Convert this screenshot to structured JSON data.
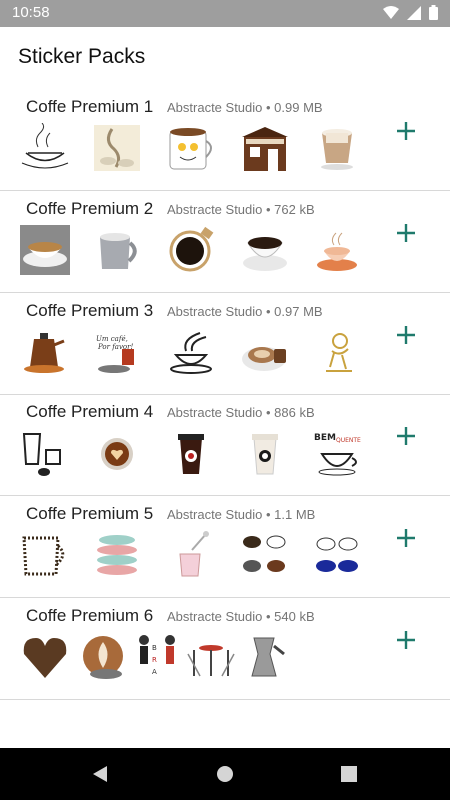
{
  "status": {
    "time": "10:58",
    "icons": [
      "wifi-icon",
      "signal-icon",
      "battery-icon"
    ]
  },
  "app": {
    "title": "Sticker Packs"
  },
  "accent_color": "#1f7a6c",
  "packs": [
    {
      "name": "Coffe Premium 1",
      "meta": "Abstracte Studio • 0.99 MB",
      "stickers": [
        "steaming-cup-sticker",
        "coffee-cups-sketch-sticker",
        "smiling-mug-sticker",
        "coffee-shop-sticker",
        "latte-glass-sticker"
      ]
    },
    {
      "name": "Coffe Premium 2",
      "meta": "Abstracte Studio • 762 kB",
      "stickers": [
        "espresso-saucer-sticker",
        "grey-mug-sticker",
        "dark-coffee-top-sticker",
        "espresso-cup-sticker",
        "orange-cup-sticker"
      ]
    },
    {
      "name": "Coffe Premium 3",
      "meta": "Abstracte Studio • 0.97 MB",
      "stickers": [
        "coffee-pot-sticker",
        "un-cafe-sign-sticker",
        "steaming-cup-line-sticker",
        "cappuccino-biscuit-sticker",
        "golden-figure-sticker"
      ]
    },
    {
      "name": "Coffe Premium 4",
      "meta": "Abstracte Studio • 886 kB",
      "stickers": [
        "coffee-maker-sticker",
        "heart-latte-sticker",
        "takeaway-cup-sticker",
        "paper-cup-sticker",
        "bem-quente-sticker"
      ]
    },
    {
      "name": "Coffe Premium 5",
      "meta": "Abstracte Studio • 1.1 MB",
      "stickers": [
        "bean-mug-sticker",
        "stacked-cups-sticker",
        "pink-latte-sticker",
        "cup-collage-sticker",
        "blue-cups-sticker"
      ]
    },
    {
      "name": "Coffe Premium 6",
      "meta": "Abstracte Studio • 540 kB",
      "stickers": [
        "bean-heart-sticker",
        "latte-art-sticker",
        "bra-sign-sticker",
        "cafe-table-sticker",
        "moka-pot-sticker"
      ]
    }
  ],
  "nav": {
    "buttons": [
      "back-icon",
      "home-icon",
      "recents-icon"
    ]
  }
}
